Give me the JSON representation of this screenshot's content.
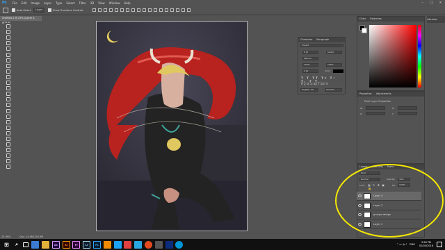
{
  "app": {
    "logo": "Ps"
  },
  "menubar": {
    "items": [
      "File",
      "Edit",
      "Image",
      "Layer",
      "Type",
      "Select",
      "Filter",
      "3D",
      "View",
      "Window",
      "Help"
    ]
  },
  "window_controls": {
    "minimize": "–",
    "maximize": "□",
    "close": "×"
  },
  "options": {
    "auto_select_label": "Auto-Select",
    "auto_select_value": "Layer",
    "show_transform_label": "Show Transform Controls"
  },
  "document": {
    "tab_title": "Untitled-1 @ 25% (Layer 4, RGB/8)",
    "status": "25.99%",
    "doc_info": "Doc: 24.9M/128.9M"
  },
  "character_panel": {
    "tabs": [
      "Character",
      "Paragraph"
    ],
    "font_family": "Impact",
    "font_size": "8 pt",
    "leading": "(Auto)",
    "tracking": "Metrics",
    "scale_v": "100%",
    "scale_h": "100%",
    "baseline": "0 pt",
    "color_label": "Color:",
    "language": "English: US",
    "antialias": "Smooth"
  },
  "color_panel": {
    "tabs": [
      "Color",
      "Swatches"
    ]
  },
  "libraries": {
    "label": "Libraries"
  },
  "properties_panel": {
    "tabs": [
      "Properties",
      "Adjustments"
    ],
    "subtitle": "Pixel Layer Properties",
    "w_label": "W:",
    "h_label": "H:",
    "x_label": "X:",
    "y_label": "Y:"
  },
  "layers_panel": {
    "tabs": [
      "Layers",
      "Channels",
      "Paths"
    ],
    "kind": "Kind",
    "blend_mode": "Normal",
    "opacity_label": "Opacity:",
    "opacity_value": "39%",
    "lock_label": "Lock:",
    "fill_label": "Fill:",
    "fill_value": "100%",
    "layers": [
      {
        "name": "Layer 4",
        "active": true
      },
      {
        "name": "Layer 3",
        "active": false
      },
      {
        "name": "grunge design",
        "active": false
      },
      {
        "name": "Layer 1",
        "active": false
      }
    ]
  },
  "taskbar": {
    "apps": [
      "Ae",
      "Ai",
      "Pr",
      "Lr",
      "Ps"
    ],
    "language": "ENG",
    "time": "3:28 PM",
    "date": "02/05/2018"
  },
  "colors": {
    "ps_blue": "#31a8ff",
    "annotation": "#f5e800",
    "costume": "#232323",
    "cape": "#b8221f",
    "hair": "#e0c860"
  }
}
